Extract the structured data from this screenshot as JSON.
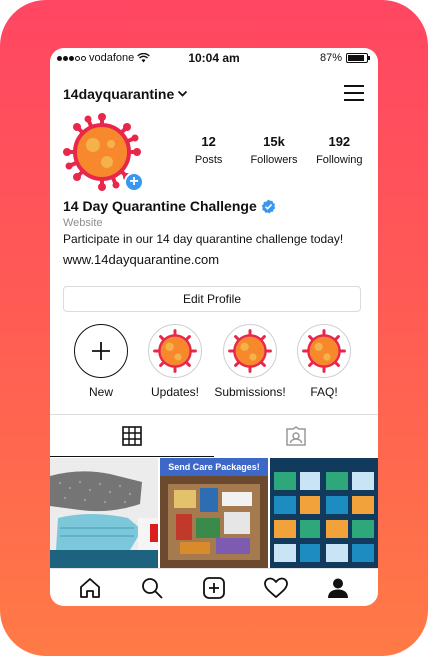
{
  "status_bar": {
    "carrier": "vodafone",
    "time": "10:04 am",
    "battery_percent": "87%",
    "battery_level": 0.87
  },
  "header": {
    "username": "14dayquarantine",
    "menu_icon": "hamburger-menu-icon"
  },
  "profile": {
    "stats": [
      {
        "value": "12",
        "label": "Posts"
      },
      {
        "value": "15k",
        "label": "Followers"
      },
      {
        "value": "192",
        "label": "Following"
      }
    ],
    "name": "14 Day Quarantine Challenge",
    "category": "Website",
    "bio": "Participate in our 14 day quarantine challenge today!",
    "link": "www.14dayquarantine.com",
    "edit_button": "Edit Profile"
  },
  "highlights": [
    {
      "label": "New"
    },
    {
      "label": "Updates!"
    },
    {
      "label": "Submissions!"
    },
    {
      "label": "FAQ!"
    }
  ],
  "posts": {
    "post2_banner": "Send Care Packages!"
  },
  "colors": {
    "frame_top": "#ff4662",
    "frame_bottom": "#ff7a46",
    "verified_blue": "#3897f0",
    "virus_red": "#e8274a",
    "virus_orange": "#f7892c"
  },
  "icons": [
    "home-icon",
    "search-icon",
    "add-post-icon",
    "heart-icon",
    "profile-icon",
    "grid-icon",
    "tagged-icon",
    "verified-badge-icon",
    "chevron-down-icon",
    "wifi-icon"
  ]
}
